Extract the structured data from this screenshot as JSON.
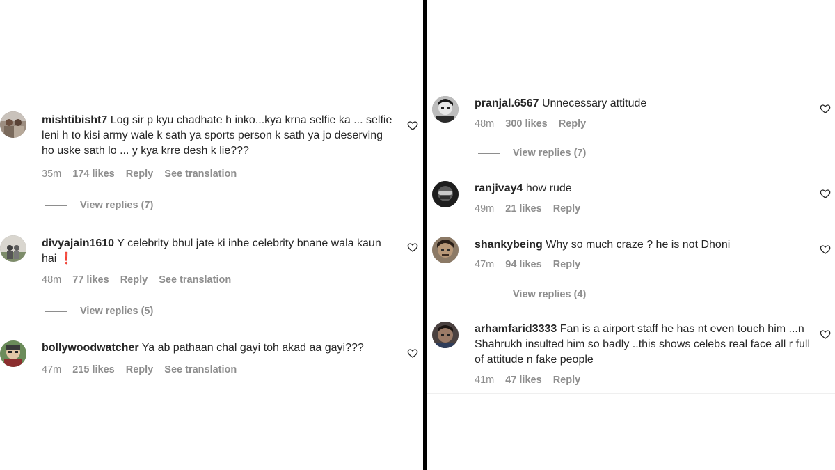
{
  "left": {
    "comments": [
      {
        "username": "mishtibisht7",
        "text": "Log sir p kyu chadhate h inko...kya krna selfie ka ... selfie leni h to kisi army wale k sath ya sports person k sath ya jo deserving ho uske sath lo ... y kya krre desh k lie???",
        "time": "35m",
        "likes": "174 likes",
        "reply": "Reply",
        "translation": "See translation",
        "view_replies": "View replies (7)"
      },
      {
        "username": "divyajain1610",
        "text": "Y celebrity bhul jate ki inhe celebrity bnane wala kaun hai",
        "emoji": "❗",
        "time": "48m",
        "likes": "77 likes",
        "reply": "Reply",
        "translation": "See translation",
        "view_replies": "View replies (5)"
      },
      {
        "username": "bollywoodwatcher",
        "text": "Ya ab pathaan chal gayi toh akad aa gayi???",
        "time": "47m",
        "likes": "215 likes",
        "reply": "Reply",
        "translation": "See translation"
      }
    ]
  },
  "right": {
    "comments": [
      {
        "username": "pranjal.6567",
        "text": "Unnecessary attitude",
        "time": "48m",
        "likes": "300 likes",
        "reply": "Reply",
        "view_replies": "View replies (7)"
      },
      {
        "username": "ranjivay4",
        "text": "how rude",
        "time": "49m",
        "likes": "21 likes",
        "reply": "Reply"
      },
      {
        "username": "shankybeing",
        "text": "Why so much craze ? he is not Dhoni",
        "time": "47m",
        "likes": "94 likes",
        "reply": "Reply",
        "view_replies": "View replies (4)"
      },
      {
        "username": "arhamfarid3333",
        "text": "Fan is a airport staff he has nt even touch him ...n Shahrukh insulted him so badly ..this shows celebs real face all r full of attitude n fake people",
        "time": "41m",
        "likes": "47 likes",
        "reply": "Reply"
      }
    ]
  },
  "icons": {
    "like": "heart-outline-icon"
  }
}
